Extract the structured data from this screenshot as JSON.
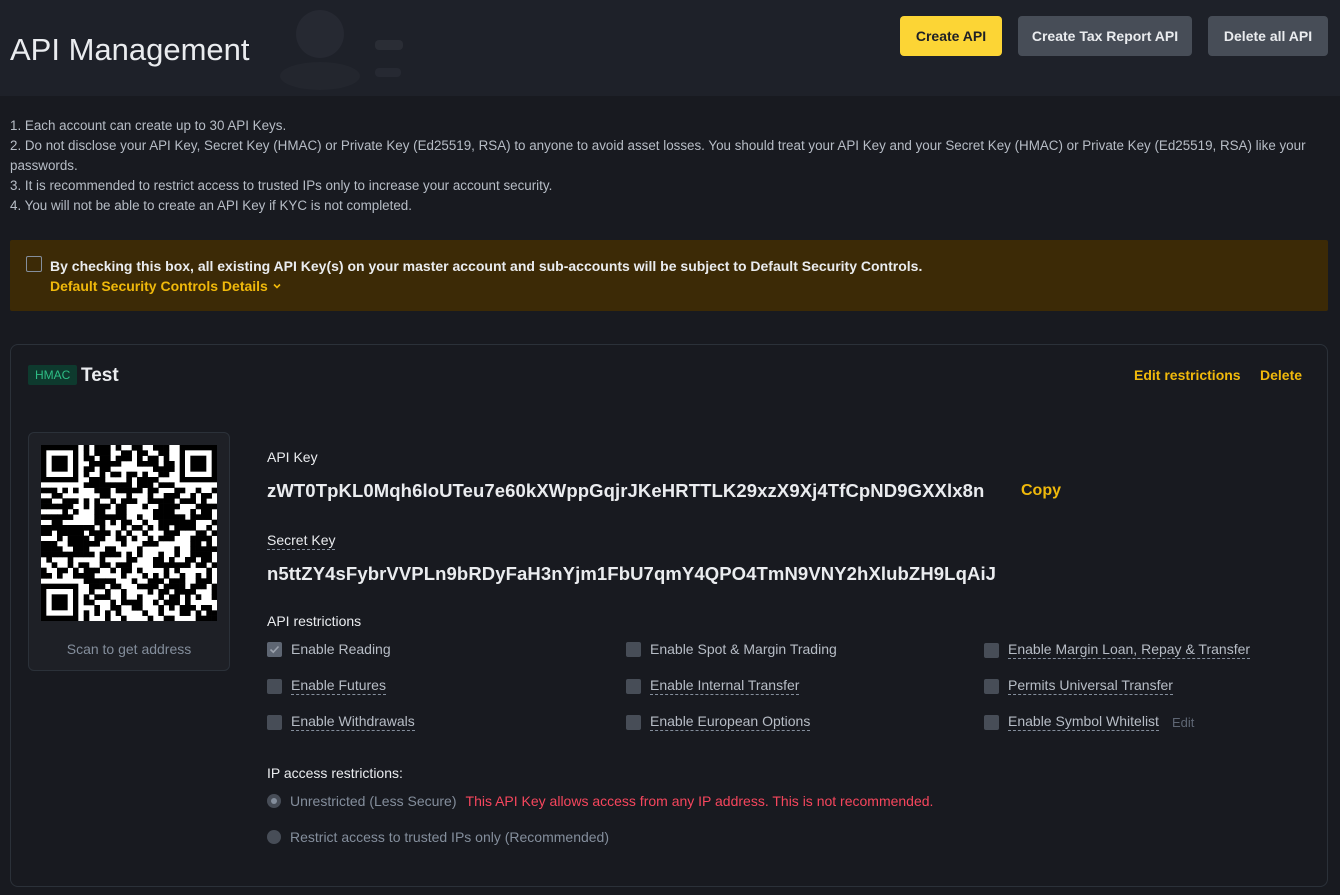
{
  "header": {
    "title": "API Management",
    "create_api_label": "Create API",
    "create_tax_label": "Create Tax Report API",
    "delete_all_label": "Delete all API"
  },
  "notes": [
    "1. Each account can create up to 30 API Keys.",
    "2. Do not disclose your API Key, Secret Key (HMAC) or Private Key (Ed25519, RSA) to anyone to avoid asset losses. You should treat your API Key and your Secret Key (HMAC) or Private Key (Ed25519, RSA) like your passwords.",
    "3. It is recommended to restrict access to trusted IPs only to increase your account security.",
    "4. You will not be able to create an API Key if KYC is not completed."
  ],
  "security_notice": {
    "text": "By checking this box, all existing API Key(s) on your master account and sub-accounts will be subject to Default Security Controls.",
    "link_label": "Default Security Controls Details",
    "checked": false
  },
  "api_card": {
    "badge": "HMAC",
    "name": "Test",
    "edit_restrictions_label": "Edit restrictions",
    "delete_label": "Delete",
    "qr_caption": "Scan to get address",
    "api_key_label": "API Key",
    "api_key_value": "zWT0TpKL0Mqh6loUTeu7e60kXWppGqjrJKeHRTTLK29xzX9Xj4TfCpND9GXXlx8n",
    "copy_label": "Copy",
    "secret_key_label": "Secret Key",
    "secret_key_value": "n5ttZY4sFybrVVPLn9bRDyFaH3nYjm1FbU7qmY4QPO4TmN9VNY2hXlubZH9LqAiJ",
    "restrictions_label": "API restrictions",
    "permissions": [
      {
        "label": "Enable Reading",
        "checked": true,
        "dashed": false
      },
      {
        "label": "Enable Spot & Margin Trading",
        "checked": false,
        "dashed": false
      },
      {
        "label": "Enable Margin Loan, Repay & Transfer",
        "checked": false,
        "dashed": true
      },
      {
        "label": "Enable Futures",
        "checked": false,
        "dashed": true
      },
      {
        "label": "Enable Internal Transfer",
        "checked": false,
        "dashed": true
      },
      {
        "label": "Permits Universal Transfer",
        "checked": false,
        "dashed": true
      },
      {
        "label": "Enable Withdrawals",
        "checked": false,
        "dashed": true
      },
      {
        "label": "Enable European Options",
        "checked": false,
        "dashed": true
      },
      {
        "label": "Enable Symbol Whitelist",
        "checked": false,
        "dashed": true
      }
    ],
    "whitelist_edit_label": "Edit",
    "ip_label": "IP access restrictions:",
    "ip_options": [
      {
        "label": "Unrestricted (Less Secure)",
        "selected": true,
        "warning": "This API Key allows access from any IP address. This is not recommended."
      },
      {
        "label": "Restrict access to trusted IPs only (Recommended)",
        "selected": false,
        "warning": ""
      }
    ]
  },
  "colors": {
    "background": "#181a20",
    "accent_yellow": "#fcd535",
    "link_yellow": "#f0b90b",
    "danger": "#f6465d",
    "hmac_green": "#2ebd85"
  }
}
